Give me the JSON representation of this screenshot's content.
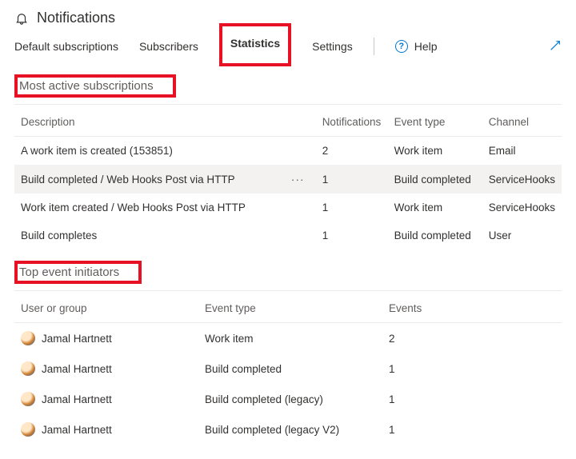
{
  "header": {
    "title": "Notifications"
  },
  "tabs": {
    "default_subscriptions": "Default subscriptions",
    "subscribers": "Subscribers",
    "statistics": "Statistics",
    "settings": "Settings",
    "help": "Help"
  },
  "sections": {
    "most_active": "Most active subscriptions",
    "top_initiators": "Top event initiators"
  },
  "table1": {
    "headers": {
      "description": "Description",
      "notifications": "Notifications",
      "event_type": "Event type",
      "channel": "Channel"
    },
    "rows": [
      {
        "description": "A work item is created (153851)",
        "notifications": "2",
        "event_type": "Work item",
        "channel": "Email",
        "highlight": false,
        "ellipsis": false
      },
      {
        "description": "Build completed / Web Hooks Post via HTTP",
        "notifications": "1",
        "event_type": "Build completed",
        "channel": "ServiceHooks",
        "highlight": true,
        "ellipsis": true
      },
      {
        "description": "Work item created / Web Hooks Post via HTTP",
        "notifications": "1",
        "event_type": "Work item",
        "channel": "ServiceHooks",
        "highlight": false,
        "ellipsis": false
      },
      {
        "description": "Build completes",
        "notifications": "1",
        "event_type": "Build completed",
        "channel": "User",
        "highlight": false,
        "ellipsis": false
      }
    ]
  },
  "table2": {
    "headers": {
      "user": "User or group",
      "event_type": "Event type",
      "events": "Events"
    },
    "rows": [
      {
        "user": "Jamal Hartnett",
        "event_type": "Work item",
        "events": "2"
      },
      {
        "user": "Jamal Hartnett",
        "event_type": "Build completed",
        "events": "1"
      },
      {
        "user": "Jamal Hartnett",
        "event_type": "Build completed (legacy)",
        "events": "1"
      },
      {
        "user": "Jamal Hartnett",
        "event_type": "Build completed (legacy V2)",
        "events": "1"
      }
    ]
  },
  "icons": {
    "ellipsis": "···"
  }
}
